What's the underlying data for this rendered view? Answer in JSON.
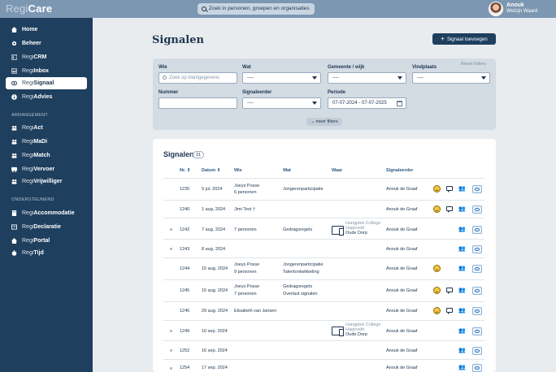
{
  "app": {
    "logo_prefix": "Regi",
    "logo_suffix": "Care"
  },
  "search": {
    "placeholder": "Zoek in personen, groepen en organisaties"
  },
  "user": {
    "name": "Anouk",
    "org": "Welzijn Waard"
  },
  "sidebar": {
    "items": [
      {
        "prefix": "",
        "label": "Home",
        "icon": "home-icon"
      },
      {
        "prefix": "",
        "label": "Beheer",
        "icon": "gear-icon"
      },
      {
        "prefix": "Regi",
        "label": "CRM",
        "icon": "id-card-icon"
      },
      {
        "prefix": "Regi",
        "label": "Inbox",
        "icon": "inbox-icon"
      },
      {
        "prefix": "Regi",
        "label": "Signaal",
        "icon": "eye-icon"
      },
      {
        "prefix": "Regi",
        "label": "Advies",
        "icon": "info-icon"
      }
    ],
    "section_arrangement": "ARRANGEMENT",
    "arrangement_items": [
      {
        "prefix": "Regi",
        "label": "Act",
        "icon": "people-icon"
      },
      {
        "prefix": "Regi",
        "label": "MaDi",
        "icon": "people-icon"
      },
      {
        "prefix": "Regi",
        "label": "Match",
        "icon": "people-icon"
      },
      {
        "prefix": "Regi",
        "label": "Vervoer",
        "icon": "bus-icon"
      },
      {
        "prefix": "Regi",
        "label": "Vrijwilliger",
        "icon": "people-icon"
      }
    ],
    "section_ondersteunend": "ONDERSTEUNEND",
    "support_items": [
      {
        "prefix": "Regi",
        "label": "Accommodatie",
        "icon": "building-icon"
      },
      {
        "prefix": "Regi",
        "label": "Declaratie",
        "icon": "document-icon"
      },
      {
        "prefix": "Regi",
        "label": "Portal",
        "icon": "home-icon"
      },
      {
        "prefix": "Regi",
        "label": "Tijd",
        "icon": "stopwatch-icon"
      }
    ]
  },
  "page": {
    "title": "Signalen",
    "add_button": "Signaal toevoegen"
  },
  "filters": {
    "reset": "Reset Filters",
    "wie_label": "Wie",
    "wie_placeholder": "Zoek op klantgegevens",
    "wat_label": "Wat",
    "wat_value": "----",
    "gemeente_label": "Gemeente / wijk",
    "gemeente_value": "----",
    "vindplaats_label": "Vindplaats",
    "vindplaats_value": "----",
    "nummer_label": "Nummer",
    "signaleerder_label": "Signaleerder",
    "signaleerder_value": "----",
    "periode_label": "Periode",
    "periode_value": "07-07-2024 - 07-07-2025",
    "meer": "meer filters"
  },
  "table": {
    "title": "Signalen",
    "count": "31",
    "headers": {
      "nr": "Nr.",
      "datum": "Datum",
      "wie": "Wie",
      "wat": "Wat",
      "waar": "Waar",
      "signaleerder": "Signaleerder"
    },
    "rows": [
      {
        "nr": "1235",
        "datum": "9 jul. 2024",
        "wie1": "Joeys Posse",
        "wie2": "6 personen",
        "wat1": "Jongerenparticipatie",
        "wat2": "",
        "waar1": "",
        "waar2": "",
        "signaleerder": "Anouk de Graaf"
      },
      {
        "nr": "1240",
        "datum": "1 aug. 2024",
        "wie1": "Jimi Test †",
        "wie2": "",
        "wat1": "",
        "wat2": "",
        "waar1": "",
        "waar2": "",
        "signaleerder": "Anouk de Graaf"
      },
      {
        "nr": "1242",
        "datum": "7 aug. 2024",
        "wie1": "7 personen",
        "wie2": "",
        "wat1": "Gedragsregels",
        "wat2": "",
        "waar1": "Hangplek College Hageveld",
        "waar2": "Oude Dorp",
        "signaleerder": "Anouk de Graaf"
      },
      {
        "nr": "1243",
        "datum": "8 aug. 2024",
        "wie1": "",
        "wie2": "",
        "wat1": "",
        "wat2": "",
        "waar1": "",
        "waar2": "",
        "signaleerder": "Anouk de Graaf"
      },
      {
        "nr": "1244",
        "datum": "15 aug. 2024",
        "wie1": "Joeys Posse",
        "wie2": "9 personen",
        "wat1": "Jongerenparticipatie",
        "wat2": "Talentontwikkeling",
        "waar1": "",
        "waar2": "",
        "signaleerder": "Anouk de Graaf"
      },
      {
        "nr": "1245",
        "datum": "15 aug. 2024",
        "wie1": "Joeys Posse",
        "wie2": "7 personen",
        "wat1": "Gedragsregels",
        "wat2": "Overlast signalen",
        "waar1": "",
        "waar2": "",
        "signaleerder": "Anouk de Graaf"
      },
      {
        "nr": "1246",
        "datum": "29 aug. 2024",
        "wie1": "Elisabeth van Jansen",
        "wie2": "",
        "wat1": "",
        "wat2": "",
        "waar1": "",
        "waar2": "",
        "signaleerder": "Anouk de Graaf"
      },
      {
        "nr": "1249",
        "datum": "10 sep. 2024",
        "wie1": "",
        "wie2": "",
        "wat1": "",
        "wat2": "",
        "waar1": "Hangplek College Hageveld",
        "waar2": "Oude Dorp",
        "signaleerder": "Anouk de Graaf"
      },
      {
        "nr": "1252",
        "datum": "16 sep. 2024",
        "wie1": "",
        "wie2": "",
        "wat1": "",
        "wat2": "",
        "waar1": "",
        "waar2": "",
        "signaleerder": "Anouk de Graaf"
      },
      {
        "nr": "1254",
        "datum": "17 sep. 2024",
        "wie1": "",
        "wie2": "",
        "wat1": "",
        "wat2": "",
        "waar1": "",
        "waar2": "",
        "signaleerder": "Anouk de Graaf"
      }
    ]
  }
}
